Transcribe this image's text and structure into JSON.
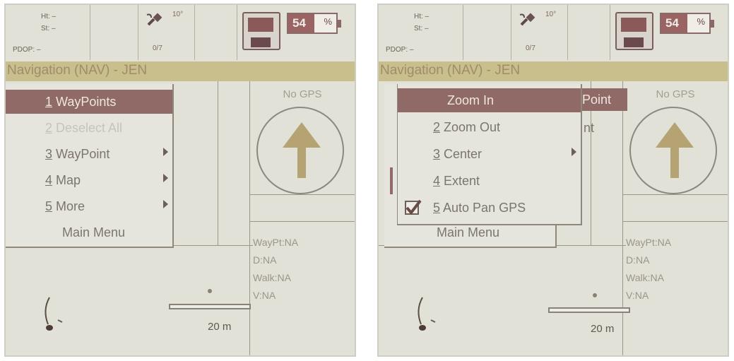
{
  "screens": [
    {
      "status": {
        "line1": "Ht: –",
        "line2": "St: –",
        "line3": "PDOP: –",
        "sat_degrees": "10°",
        "sat_count": "0/7",
        "battery_value": "54",
        "battery_unit": "%",
        "battery_level": 0.54
      },
      "title": "Navigation (NAV) - JEN",
      "side": {
        "no_gps": "No GPS",
        "waypt": "WayPt:NA",
        "d": "D:NA",
        "walk": "Walk:NA",
        "v": "V:NA"
      },
      "scale": "20 m",
      "menu": [
        {
          "num": "1",
          "label": " WayPoints"
        },
        {
          "num": "2",
          "label": " Deselect All"
        },
        {
          "num": "3",
          "label": " WayPoint"
        },
        {
          "num": "4",
          "label": " Map"
        },
        {
          "num": "5",
          "label": " More"
        },
        {
          "label": "Main Menu"
        }
      ]
    },
    {
      "status": {
        "line1": "Ht: –",
        "line2": "St: –",
        "line3": "PDOP: –",
        "sat_degrees": "10°",
        "sat_count": "0/7",
        "battery_value": "54",
        "battery_unit": "%",
        "battery_level": 0.54
      },
      "title": "Navigation (NAV) - JEN",
      "side": {
        "no_gps": "No GPS",
        "waypt": "WayPt:NA",
        "d": "D:NA",
        "walk": "Walk:NA",
        "v": "V:NA"
      },
      "scale": "20 m",
      "background_menu": {
        "partial_1": "Point",
        "partial_2": "nt",
        "main_menu": "Main Menu"
      },
      "menu": [
        {
          "label": "Zoom In"
        },
        {
          "num": "2",
          "label": " Zoom Out"
        },
        {
          "num": "3",
          "label": " Center"
        },
        {
          "num": "4",
          "label": " Extent"
        },
        {
          "num": "5",
          "label": " Auto Pan GPS"
        }
      ]
    }
  ]
}
